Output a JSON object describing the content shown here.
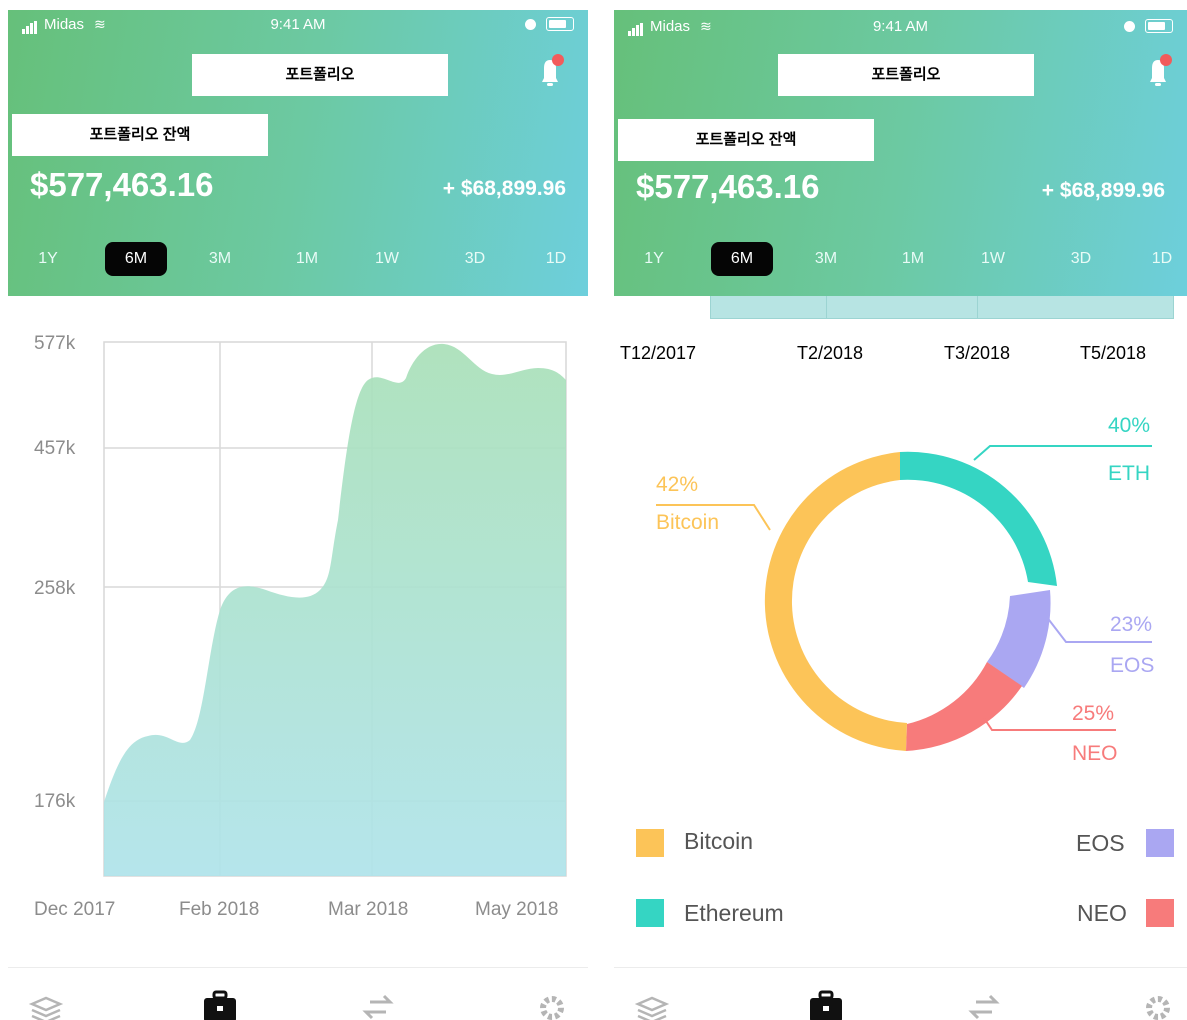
{
  "status": {
    "carrier": "Midas",
    "time": "9:41 AM"
  },
  "header": {
    "title": "포트폴리오",
    "balance_label": "포트폴리오 잔액",
    "balance": "$577,463.16",
    "change": "+ $68,899.96"
  },
  "ranges": [
    "1Y",
    "6M",
    "3M",
    "1M",
    "1W",
    "3D",
    "1D"
  ],
  "active_range": "6M",
  "colors": {
    "header_start": "#66c07a",
    "header_end": "#6dcfdc",
    "bitcoin": "#fcc458",
    "ethereum": "#35d5c3",
    "eos": "#aaa7f2",
    "neo": "#f77b7b"
  },
  "area_chart": {
    "yticks": [
      "577k",
      "457k",
      "258k",
      "176k"
    ],
    "xticks": [
      "Dec 2017",
      "Feb 2018",
      "Mar 2018",
      "May 2018"
    ]
  },
  "dates": [
    "T12/2017",
    "T2/2018",
    "T3/2018",
    "T5/2018"
  ],
  "chart_data": [
    {
      "type": "area",
      "x": [
        "Dec 2017",
        "Feb 2018",
        "Mar 2018",
        "May 2018"
      ],
      "series": [
        {
          "values": [
            176,
            258,
            457,
            577
          ]
        }
      ],
      "ytick_values": [
        176,
        258,
        457,
        577
      ],
      "ylabel": "",
      "xlabel": "",
      "grid": true
    },
    {
      "type": "pie",
      "labels": [
        "ETH",
        "EOS",
        "NEO",
        "Bitcoin"
      ],
      "values": [
        40,
        23,
        25,
        42
      ],
      "value_labels": [
        "40%",
        "23%",
        "25%",
        "42%"
      ],
      "legend": [
        "Bitcoin",
        "Ethereum",
        "EOS",
        "NEO"
      ]
    }
  ],
  "icons": [
    "bell-icon",
    "wallet-stack-icon",
    "briefcase-icon",
    "exchange-icon",
    "gear-icon"
  ]
}
